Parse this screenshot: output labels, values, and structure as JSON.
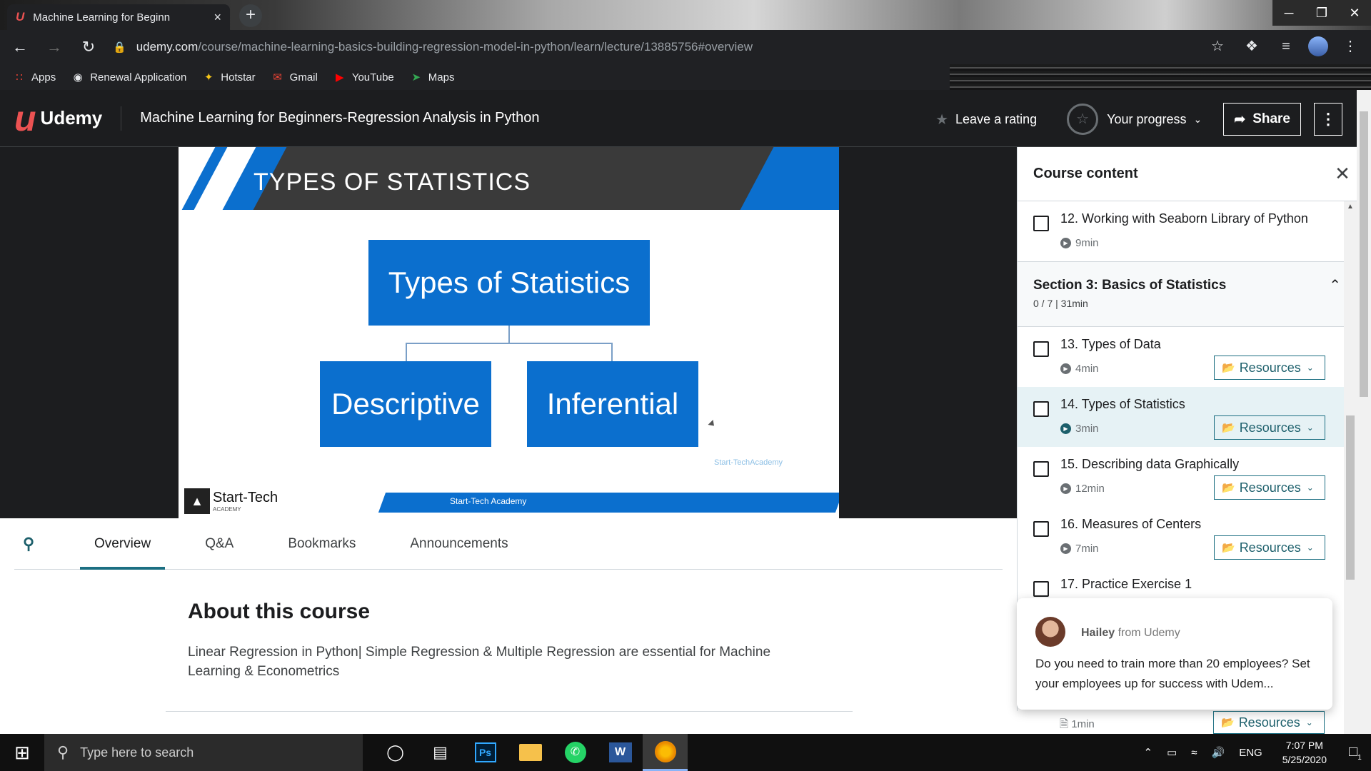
{
  "browser": {
    "tab_title": "Machine Learning for Beginn",
    "tab_favicon": "U",
    "tab_close": "×",
    "new_tab": "+",
    "url_host": "udemy.com",
    "url_path": "/course/machine-learning-basics-building-regression-model-in-python/learn/lecture/13885756#overview",
    "window_controls": [
      "─",
      "❐",
      "✕"
    ],
    "bookmarks": [
      {
        "label": "Apps",
        "icon": "apps-grid-icon"
      },
      {
        "label": "Renewal Application",
        "icon": "globe-icon"
      },
      {
        "label": "Hotstar",
        "icon": "hotstar-icon"
      },
      {
        "label": "Gmail",
        "icon": "gmail-icon"
      },
      {
        "label": "YouTube",
        "icon": "youtube-icon"
      },
      {
        "label": "Maps",
        "icon": "maps-icon"
      }
    ]
  },
  "header": {
    "logo_text": "Udemy",
    "course_title": "Machine Learning for Beginners-Regression Analysis in Python",
    "rating_label": "Leave a rating",
    "progress_label": "Your progress",
    "share_label": "Share"
  },
  "slide": {
    "title": "TYPES OF STATISTICS",
    "root_box": "Types of Statistics",
    "left_box": "Descriptive",
    "right_box": "Inferential",
    "footer": "Start-Tech Academy",
    "logo_name": "Start-Tech",
    "logo_sub": "ACADEMY",
    "watermark": "Start-TechAcademy"
  },
  "tabs": {
    "items": [
      "Overview",
      "Q&A",
      "Bookmarks",
      "Announcements"
    ],
    "active": "Overview"
  },
  "about": {
    "heading": "About this course",
    "description": "Linear Regression in Python| Simple Regression & Multiple Regression are essential for Machine Learning & Econometrics"
  },
  "sidebar": {
    "title": "Course content",
    "lectures_top": [
      {
        "title": "12. Working with Seaborn Library of Python",
        "duration": "9min"
      }
    ],
    "section": {
      "title": "Section 3: Basics of Statistics",
      "meta": "0 / 7 | 31min"
    },
    "lectures": [
      {
        "title": "13. Types of Data",
        "duration": "4min",
        "resources": "Resources"
      },
      {
        "title": "14. Types of Statistics",
        "duration": "3min",
        "resources": "Resources"
      },
      {
        "title": "15. Describing data Graphically",
        "duration": "12min",
        "resources": "Resources"
      },
      {
        "title": "16. Measures of Centers",
        "duration": "7min",
        "resources": "Resources"
      },
      {
        "title": "17. Practice Exercise 1",
        "duration": "",
        "resources": ""
      }
    ],
    "tail": {
      "duration": "1min",
      "resources": "Resources"
    }
  },
  "chat": {
    "name": "Hailey",
    "from": "from Udemy",
    "message": "Do you need to train more than 20 employees? Set your employees up for success with Udem..."
  },
  "taskbar": {
    "search_placeholder": "Type here to search",
    "language": "ENG",
    "time": "7:07 PM",
    "date": "5/25/2020",
    "notification_count": "1"
  },
  "colors": {
    "udemy_dark": "#1c1d1f",
    "slide_blue": "#0b6fce",
    "accent_teal": "#1c6f82",
    "current_lecture_bg": "#e6f2f5"
  }
}
